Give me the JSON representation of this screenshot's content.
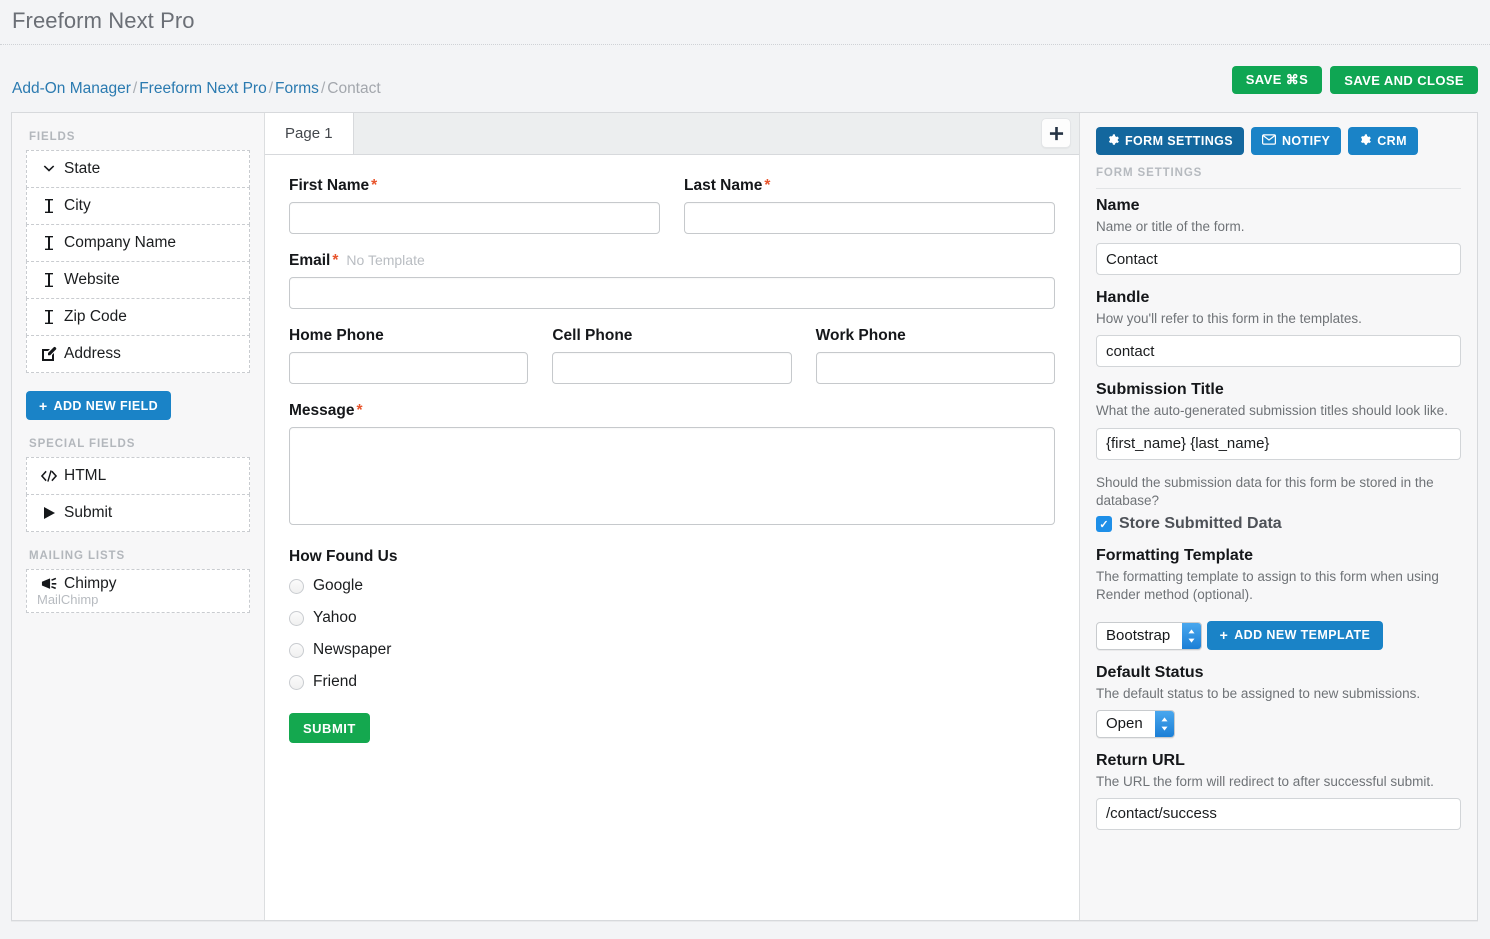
{
  "app": {
    "title": "Freeform Next Pro"
  },
  "breadcrumb": {
    "items": [
      {
        "label": "Add-On Manager",
        "link": true
      },
      {
        "label": "Freeform Next Pro",
        "link": true
      },
      {
        "label": "Forms",
        "link": true
      },
      {
        "label": "Contact",
        "link": false
      }
    ],
    "separator": "/"
  },
  "header_actions": {
    "save": "SAVE ⌘S",
    "save_and_close": "SAVE AND CLOSE"
  },
  "sidebar": {
    "fields_heading": "FIELDS",
    "fields": [
      {
        "label": "State",
        "icon": "chevron-down-icon"
      },
      {
        "label": "City",
        "icon": "text-cursor-icon"
      },
      {
        "label": "Company Name",
        "icon": "text-cursor-icon"
      },
      {
        "label": "Website",
        "icon": "text-cursor-icon"
      },
      {
        "label": "Zip Code",
        "icon": "text-cursor-icon"
      },
      {
        "label": "Address",
        "icon": "pencil-square-icon"
      }
    ],
    "add_new_field": "ADD NEW FIELD",
    "special_heading": "SPECIAL FIELDS",
    "special_fields": [
      {
        "label": "HTML",
        "icon": "code-icon"
      },
      {
        "label": "Submit",
        "icon": "play-icon"
      }
    ],
    "mailing_heading": "MAILING LISTS",
    "mailing_lists": [
      {
        "label": "Chimpy",
        "sub": "MailChimp",
        "icon": "bullhorn-icon"
      }
    ]
  },
  "builder": {
    "tabs": [
      {
        "label": "Page 1",
        "active": true
      }
    ],
    "add_page_icon": "plus-icon",
    "fields": {
      "first_name": {
        "label": "First Name",
        "required": true,
        "value": ""
      },
      "last_name": {
        "label": "Last Name",
        "required": true,
        "value": ""
      },
      "email": {
        "label": "Email",
        "required": true,
        "note": "No Template",
        "value": ""
      },
      "home_phone": {
        "label": "Home Phone",
        "required": false,
        "value": ""
      },
      "cell_phone": {
        "label": "Cell Phone",
        "required": false,
        "value": ""
      },
      "work_phone": {
        "label": "Work Phone",
        "required": false,
        "value": ""
      },
      "message": {
        "label": "Message",
        "required": true,
        "value": ""
      },
      "how_found_us": {
        "label": "How Found Us",
        "options": [
          "Google",
          "Yahoo",
          "Newspaper",
          "Friend"
        ],
        "selected": ""
      }
    },
    "submit_label": "SUBMIT"
  },
  "settings": {
    "tabs": [
      {
        "label": "FORM SETTINGS",
        "icon": "gear-icon",
        "active": true
      },
      {
        "label": "NOTIFY",
        "icon": "envelope-icon",
        "active": false
      },
      {
        "label": "CRM",
        "icon": "gear-icon",
        "active": false
      }
    ],
    "section_heading": "FORM SETTINGS",
    "name": {
      "label": "Name",
      "desc": "Name or title of the form.",
      "value": "Contact"
    },
    "handle": {
      "label": "Handle",
      "desc": "How you'll refer to this form in the templates.",
      "value": "contact"
    },
    "submission_title": {
      "label": "Submission Title",
      "desc": "What the auto-generated submission titles should look like.",
      "value": "{first_name} {last_name}"
    },
    "store_data": {
      "desc": "Should the submission data for this form be stored in the database?",
      "label": "Store Submitted Data",
      "checked": true,
      "check_glyph": "✓"
    },
    "formatting_template": {
      "label": "Formatting Template",
      "desc": "The formatting template to assign to this form when using Render method (optional).",
      "value": "Bootstrap",
      "add_button": "ADD NEW TEMPLATE"
    },
    "default_status": {
      "label": "Default Status",
      "desc": "The default status to be assigned to new submissions.",
      "value": "Open"
    },
    "return_url": {
      "label": "Return URL",
      "desc": "The URL the form will redirect to after successful submit.",
      "value": "/contact/success"
    }
  },
  "colors": {
    "green": "#0fa653",
    "blue": "#1a83c7",
    "blue_active": "#13679e",
    "required": "#e8552d",
    "link": "#2a7ab0"
  }
}
